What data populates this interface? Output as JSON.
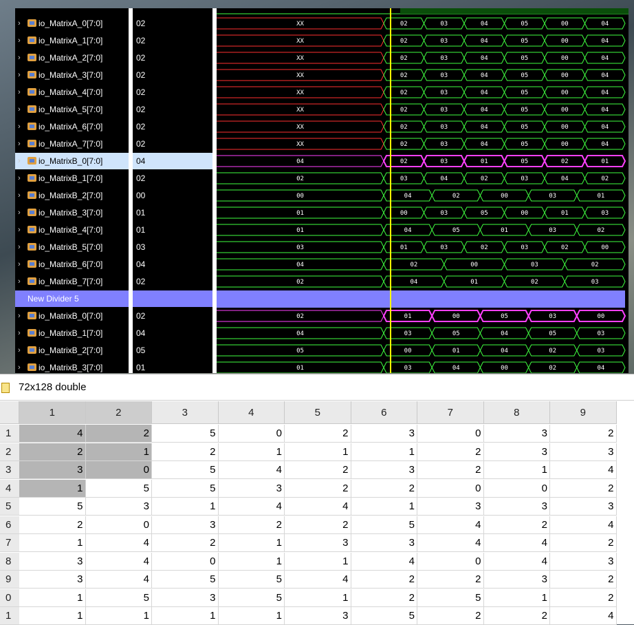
{
  "waveform": {
    "signals": [
      {
        "name": "io_MatrixA_0[7:0]",
        "value": "02"
      },
      {
        "name": "io_MatrixA_1[7:0]",
        "value": "02"
      },
      {
        "name": "io_MatrixA_2[7:0]",
        "value": "02"
      },
      {
        "name": "io_MatrixA_3[7:0]",
        "value": "02"
      },
      {
        "name": "io_MatrixA_4[7:0]",
        "value": "02"
      },
      {
        "name": "io_MatrixA_5[7:0]",
        "value": "02"
      },
      {
        "name": "io_MatrixA_6[7:0]",
        "value": "02"
      },
      {
        "name": "io_MatrixA_7[7:0]",
        "value": "02"
      },
      {
        "name": "io_MatrixB_0[7:0]",
        "value": "04",
        "selected": true
      },
      {
        "name": "io_MatrixB_1[7:0]",
        "value": "02"
      },
      {
        "name": "io_MatrixB_2[7:0]",
        "value": "00"
      },
      {
        "name": "io_MatrixB_3[7:0]",
        "value": "01"
      },
      {
        "name": "io_MatrixB_4[7:0]",
        "value": "01"
      },
      {
        "name": "io_MatrixB_5[7:0]",
        "value": "03"
      },
      {
        "name": "io_MatrixB_6[7:0]",
        "value": "04"
      },
      {
        "name": "io_MatrixB_7[7:0]",
        "value": "02"
      },
      {
        "name": "New Divider 5",
        "value": "",
        "divider": true
      },
      {
        "name": "io_MatrixB_0[7:0]",
        "value": "02"
      },
      {
        "name": "io_MatrixB_1[7:0]",
        "value": "04"
      },
      {
        "name": "io_MatrixB_2[7:0]",
        "value": "05"
      },
      {
        "name": "io_MatrixB_3[7:0]",
        "value": "01"
      }
    ],
    "traces": [
      {
        "color": "#ff3030",
        "first": "XX",
        "rest": [
          "02",
          "03",
          "04",
          "05",
          "00",
          "04"
        ]
      },
      {
        "color": "#ff3030",
        "first": "XX",
        "rest": [
          "02",
          "03",
          "04",
          "05",
          "00",
          "04"
        ]
      },
      {
        "color": "#ff3030",
        "first": "XX",
        "rest": [
          "02",
          "03",
          "04",
          "05",
          "00",
          "04"
        ]
      },
      {
        "color": "#ff3030",
        "first": "XX",
        "rest": [
          "02",
          "03",
          "04",
          "05",
          "00",
          "04"
        ]
      },
      {
        "color": "#ff3030",
        "first": "XX",
        "rest": [
          "02",
          "03",
          "04",
          "05",
          "00",
          "04"
        ]
      },
      {
        "color": "#ff3030",
        "first": "XX",
        "rest": [
          "02",
          "03",
          "04",
          "05",
          "00",
          "04"
        ]
      },
      {
        "color": "#ff3030",
        "first": "XX",
        "rest": [
          "02",
          "03",
          "04",
          "05",
          "00",
          "04"
        ]
      },
      {
        "color": "#ff3030",
        "first": "XX",
        "rest": [
          "02",
          "03",
          "04",
          "05",
          "00",
          "04"
        ]
      },
      {
        "color": "#ff40ff",
        "first": "04",
        "rest": [
          "02",
          "03",
          "01",
          "05",
          "02",
          "01"
        ]
      },
      {
        "color": "#40ff40",
        "first": "02",
        "rest": [
          "03",
          "04",
          "02",
          "03",
          "04",
          "02"
        ]
      },
      {
        "color": "#40ff40",
        "first": "00",
        "rest": [
          "04",
          "02",
          "00",
          "03",
          "01"
        ]
      },
      {
        "color": "#40ff40",
        "first": "01",
        "rest": [
          "00",
          "03",
          "05",
          "00",
          "01",
          "03"
        ]
      },
      {
        "color": "#40ff40",
        "first": "01",
        "rest": [
          "04",
          "05",
          "01",
          "03",
          "02"
        ]
      },
      {
        "color": "#40ff40",
        "first": "03",
        "rest": [
          "01",
          "03",
          "02",
          "03",
          "02",
          "00"
        ]
      },
      {
        "color": "#40ff40",
        "first": "04",
        "rest": [
          "02",
          "00",
          "03",
          "02"
        ]
      },
      {
        "color": "#40ff40",
        "first": "02",
        "rest": [
          "04",
          "01",
          "02",
          "03"
        ]
      },
      {
        "divider": true
      },
      {
        "color": "#ff40ff",
        "first": "02",
        "rest": [
          "01",
          "00",
          "05",
          "03",
          "00"
        ]
      },
      {
        "color": "#40ff40",
        "first": "04",
        "rest": [
          "03",
          "05",
          "04",
          "05",
          "03"
        ]
      },
      {
        "color": "#40ff40",
        "first": "05",
        "rest": [
          "00",
          "01",
          "04",
          "02",
          "03"
        ]
      },
      {
        "color": "#40ff40",
        "first": "01",
        "rest": [
          "03",
          "04",
          "00",
          "02",
          "04"
        ]
      }
    ],
    "cursor_color": "#ffff00"
  },
  "table": {
    "title": "72x128 double",
    "columns": [
      "1",
      "2",
      "3",
      "4",
      "5",
      "6",
      "7",
      "8",
      "9"
    ],
    "row_labels": [
      "1",
      "2",
      "3",
      "4",
      "5",
      "6",
      "7",
      "8",
      "9",
      "0",
      "1"
    ],
    "rows": [
      [
        4,
        2,
        5,
        0,
        2,
        3,
        0,
        3,
        2
      ],
      [
        2,
        1,
        2,
        1,
        1,
        1,
        2,
        3,
        3
      ],
      [
        3,
        0,
        5,
        4,
        2,
        3,
        2,
        1,
        4
      ],
      [
        1,
        5,
        5,
        3,
        2,
        2,
        0,
        0,
        2
      ],
      [
        5,
        3,
        1,
        4,
        4,
        1,
        3,
        3,
        3
      ],
      [
        2,
        0,
        3,
        2,
        2,
        5,
        4,
        2,
        4
      ],
      [
        1,
        4,
        2,
        1,
        3,
        3,
        4,
        4,
        2
      ],
      [
        3,
        4,
        0,
        1,
        1,
        4,
        0,
        4,
        3
      ],
      [
        3,
        4,
        5,
        5,
        4,
        2,
        2,
        3,
        2
      ],
      [
        1,
        5,
        3,
        5,
        1,
        2,
        5,
        1,
        2
      ],
      [
        1,
        1,
        1,
        1,
        3,
        5,
        2,
        2,
        4
      ]
    ]
  }
}
